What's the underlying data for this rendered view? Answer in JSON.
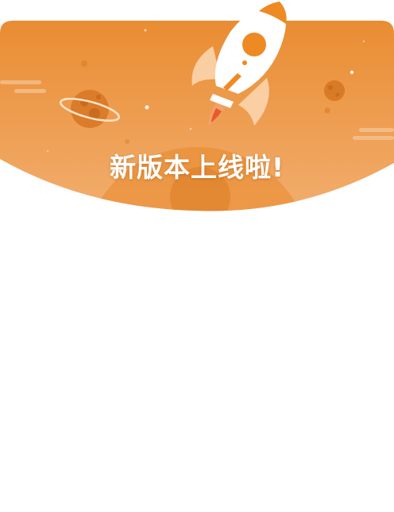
{
  "dialog": {
    "headline": "新版本上线啦!"
  },
  "theme": {
    "accent": "#EE8A23",
    "gradient_top": "#E8892C",
    "gradient_bottom": "#F2AE6E",
    "background": "#FFFFFF"
  },
  "icons": {
    "rocket": "rocket-icon",
    "planet_ringed": "ringed-planet-icon",
    "planet_small": "small-planet-icon"
  }
}
